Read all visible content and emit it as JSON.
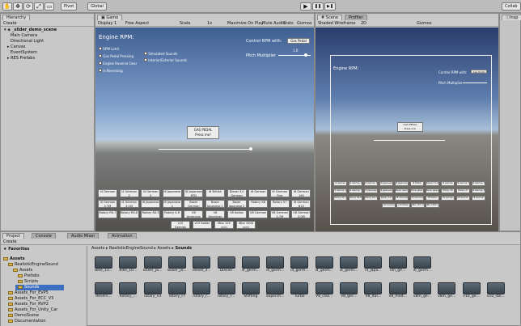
{
  "toolbar": {
    "pivot": "Pivot",
    "global": "Global",
    "play": "▶",
    "pause": "❚❚",
    "step": "▶❚",
    "collab": "Collab"
  },
  "hierarchy": {
    "tab": "Hierarchy",
    "create": "Create",
    "items": [
      "_slider_demo_scene",
      "Main Camera",
      "Directional Light",
      "Canvas",
      "EventSystem",
      "RES Prefabs"
    ]
  },
  "game": {
    "tab": "Game",
    "display": "Display 1",
    "aspect": "Free Aspect",
    "scale_label": "Scale",
    "scale_value": "1x",
    "toggles": [
      "Maximize On Play",
      "Mute Audio",
      "Stats",
      "Gizmos"
    ],
    "title": "Engine RPM:",
    "control_label": "Control RPM with:",
    "control_value": "Gas Pedal",
    "pitch_label": "Pitch Multiplier",
    "pitch_value": "1.0",
    "options_left": [
      "RPM Limit",
      "Gas Pedal Pressing",
      "Engine Reverse Gear",
      "Is Reversing"
    ],
    "options_right": [
      "Simulated Sounds",
      "Interior/Exterior Sounds"
    ],
    "gas_btn_line1": "GAS PEDAL",
    "gas_btn_line2": "Press me!",
    "preset_rows": [
      [
        "i4 German",
        "i4 German 2",
        "i4 German 3",
        "i6 Japanese",
        "i6 Japanese RTD",
        "i6 British",
        "Diesel 3.0 German",
        "i6 German",
        "i6 German Five",
        "i6 German 190"
      ],
      [
        "i4 German 2.7M",
        "i4 German 3.1M",
        "i6 Japanese",
        "i6 Japanese 2",
        "Boxer German",
        "Boxer Japanese 1",
        "Boxer Japanese 2",
        "Rotary X8",
        "Rotary X7",
        "i6 German B10"
      ],
      [
        "Rotary RX-7",
        "Rotary RX-8",
        "Rotary RX-3",
        "Rotary 4-R",
        "V8 American Classic",
        "V8 American Modern",
        "V8 Italian",
        "V8 German",
        "V8 German 2.7M",
        "V8 German 3.0M"
      ],
      [
        "v10 German",
        "v10 Italian",
        "i6bx 125 ccm",
        "i6bx 1000 ccm"
      ]
    ]
  },
  "scene": {
    "tab": "Scene",
    "profiler": "Profiler",
    "shading": "Shaded Wireframe",
    "mode": "2D",
    "gizmos": "Gizmos",
    "title": "Engine RPM:",
    "control_label": "Control RPM with:",
    "control_value": "Gas Pedal",
    "pitch_label": "Pitch Multiplier",
    "gas_line1": "GAS PEDAL",
    "gas_line2": "Press me!"
  },
  "inspector": {
    "tab": "Insp"
  },
  "project": {
    "tabs": [
      "Project",
      "Console",
      "Audio Mixer",
      "Animation"
    ],
    "create": "Create",
    "favorites": "Favorites",
    "tree": [
      "Assets",
      "RealisticEngineSound",
      "Assets",
      "Prefabs",
      "Scripts",
      "Sounds",
      "Assets_For_EVP5",
      "Assets_For_ECC_V3",
      "Assets_For_RVP2",
      "Assets_For_Unity_Car",
      "DemoScene",
      "Documentation"
    ],
    "breadcrumb": [
      "Assets",
      "RealisticEngineSound",
      "Assets",
      "Sounds"
    ],
    "row1": [
      "Bike_13...",
      "Bike_10...",
      "boxer_ja...",
      "boxer_ja...",
      "diesel_3...",
      "Diesler",
      "i4_germ...",
      "i4_germ...",
      "i4_germ...",
      "i4_germ...",
      "i4_germ...",
      "i4_japa...",
      "i4n_ge...",
      "i6_germ..."
    ],
    "row2": [
      "Revers...",
      "Rotary_...",
      "rotary_v3",
      "rotary_r7",
      "rotary_r...",
      "rotary_r...",
      "Shifting",
      "Superch...",
      "Turbo",
      "V8_clas...",
      "v8_ger...",
      "V8_Ital...",
      "V8_mod...",
      "v8m_ge...",
      "v8m_ge...",
      "v10_ge...",
      "v10_ital..."
    ]
  },
  "colors": {
    "accent": "#3d6fc1",
    "folder": "#d9b44a"
  }
}
